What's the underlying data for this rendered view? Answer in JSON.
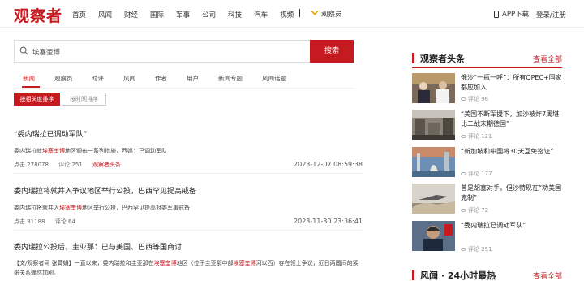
{
  "header": {
    "logo": "观察者",
    "nav": [
      "首页",
      "风闻",
      "财经",
      "国际",
      "军事",
      "公司",
      "科技",
      "汽车",
      "视频"
    ],
    "vip_label": "观察员",
    "app_label": "APP下载",
    "login_label": "登录/注册"
  },
  "search": {
    "query": "埃塞奎博",
    "button_label": "搜索"
  },
  "tabs": [
    {
      "label": "新闻",
      "active": true
    },
    {
      "label": "观察员",
      "active": false
    },
    {
      "label": "时评",
      "active": false
    },
    {
      "label": "风闻",
      "active": false
    },
    {
      "label": "作者",
      "active": false
    },
    {
      "label": "用户",
      "active": false
    },
    {
      "label": "新闻专题",
      "active": false
    },
    {
      "label": "风闻话题",
      "active": false
    }
  ],
  "sort": {
    "relevance_label": "按相关度排序",
    "time_label": "按时间排序"
  },
  "results": [
    {
      "title": "“委内瑞拉已调动军队”",
      "summary_pre": "委内瑞拉就",
      "summary_hl": "埃塞奎博",
      "summary_post": "地区颁布一系列措施，西媒：已调动军队",
      "clicks": "点击 278078",
      "comments": "评论 251",
      "source": "观察者头条",
      "date": "2023-12-07 08:59:38"
    },
    {
      "title": "委内瑞拉将就并入争议地区举行公投，巴西罕见提高戒备",
      "summary_pre": "委内瑞拉将就并入",
      "summary_hl": "埃塞奎博",
      "summary_post": "地区举行公投，巴西罕见提高对委军事戒备",
      "clicks": "点击 81188",
      "comments": "评论 64",
      "date": "2023-11-30 23:36:41"
    },
    {
      "title": "委内瑞拉公投后，圭亚那：已与美国、巴西等国商讨",
      "body_1": "【文/观察者网 张菁娟】一直以来，委内瑞拉和圭亚那在",
      "body_hl1": "埃塞奎博",
      "body_2": "地区（位于圭亚那中部",
      "body_hl2": "埃塞奎博",
      "body_3": "河以西）存在领土争议，近日两国间的紧张关系骤然加剧。"
    }
  ],
  "sidebar": {
    "title": "观察者头条",
    "more_label": "查看全部",
    "items": [
      {
        "title": "俄沙“一瓶一呼”：所有OPEC+国家都应加入",
        "views": "评论 96"
      },
      {
        "title": "“美国不断军援下，加沙被炸7周堪比二战末期德国”",
        "views": "评论 121"
      },
      {
        "title": "“新加坡和中国将30天互免签证”",
        "views": "评论 177"
      },
      {
        "title": "曾是胡塞对手，但沙特现在“劝美国克制”",
        "views": "评论 72"
      },
      {
        "title": "“委内瑞拉已调动军队”",
        "views": "评论 251"
      }
    ],
    "second_title": "风闻 · 24小时最热",
    "second_more_label": "查看全部"
  },
  "colors": {
    "accent": "#c51a1f"
  }
}
